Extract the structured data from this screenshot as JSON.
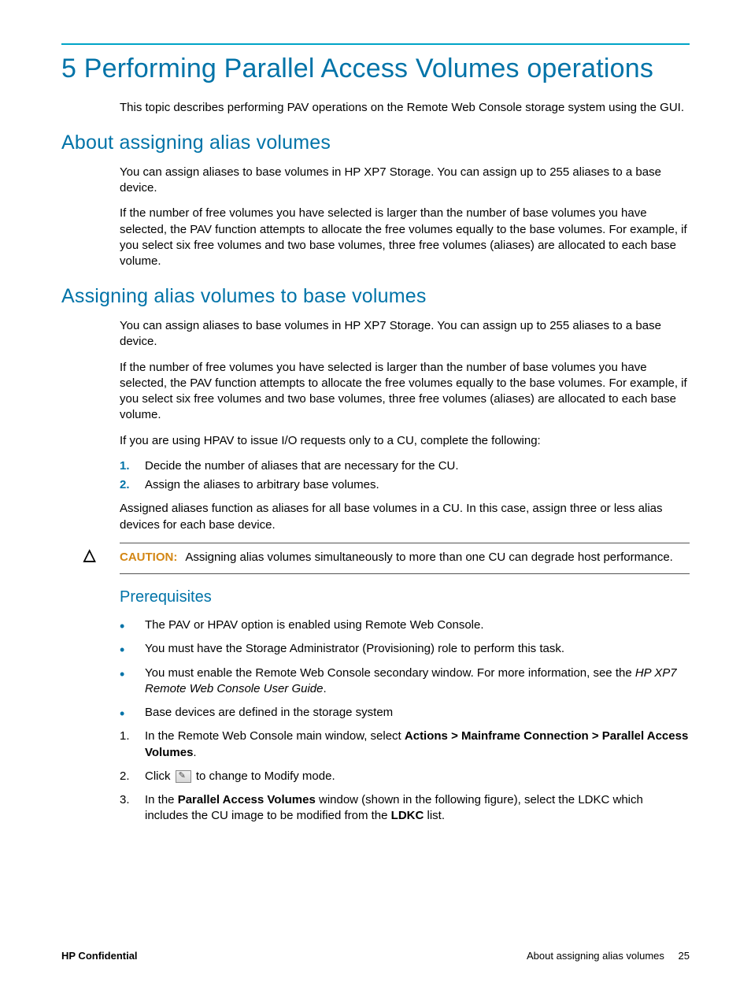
{
  "chapter": {
    "title": "5 Performing Parallel Access Volumes operations",
    "intro": "This topic describes performing PAV operations on the Remote Web Console storage system using the GUI."
  },
  "section_about": {
    "title": "About assigning alias volumes",
    "p1": "You can assign aliases to base volumes in HP XP7 Storage. You can assign up to 255 aliases to a base device.",
    "p2": "If the number of free volumes you have selected is larger than the number of base volumes you have selected, the PAV function attempts to allocate the free volumes equally to the base volumes. For example, if you select six free volumes and two base volumes, three free volumes (aliases) are allocated to each base volume."
  },
  "section_assign": {
    "title": "Assigning alias volumes to base volumes",
    "p1": "You can assign aliases to base volumes in HP XP7 Storage. You can assign up to 255 aliases to a base device.",
    "p2": "If the number of free volumes you have selected is larger than the number of base volumes you have selected, the PAV function attempts to allocate the free volumes equally to the base volumes. For example, if you select six free volumes and two base volumes, three free volumes (aliases) are allocated to each base volume.",
    "p3": "If you are using HPAV to issue I/O requests only to a CU, complete the following:",
    "ol": [
      "Decide the number of aliases that are necessary for the CU.",
      "Assign the aliases to arbitrary base volumes."
    ],
    "p4": "Assigned aliases function as aliases for all base volumes in a CU. In this case, assign three or less alias devices for each base device.",
    "caution_label": "CAUTION:",
    "caution_text": "Assigning alias volumes simultaneously to more than one CU can degrade host performance.",
    "prereq_title": "Prerequisites",
    "bullets": [
      "The PAV or HPAV option is enabled using Remote Web Console.",
      "You must have the Storage Administrator (Provisioning) role to perform this task.",
      "__rwc__",
      "Base devices are defined in the storage system"
    ],
    "bullet_rwc_pre": "You must enable the Remote Web Console secondary window. For more information, see the ",
    "bullet_rwc_em": "HP XP7 Remote Web Console User Guide",
    "bullet_rwc_post": ".",
    "steps": {
      "s1_pre": "In the Remote Web Console main window, select ",
      "s1_bold": "Actions > Mainframe Connection > Parallel Access Volumes",
      "s1_post": ".",
      "s2_pre": "Click ",
      "s2_post": " to change to Modify mode.",
      "s3_pre": "In the ",
      "s3_b1": "Parallel Access Volumes",
      "s3_mid": " window (shown in the following figure), select the LDKC which includes the CU image to be modified from the ",
      "s3_b2": "LDKC",
      "s3_post": " list."
    }
  },
  "footer": {
    "left": "HP Confidential",
    "right_label": "About assigning alias volumes",
    "page": "25"
  }
}
